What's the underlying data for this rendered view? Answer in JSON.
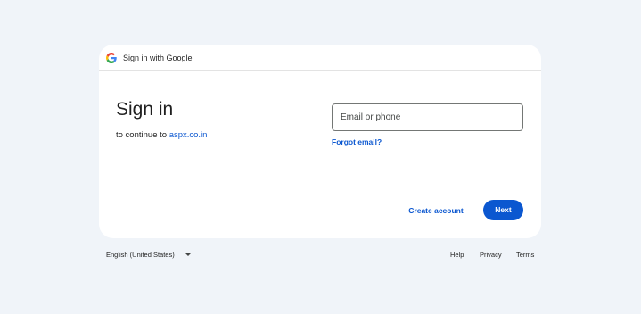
{
  "header": {
    "logo": "google-g-icon",
    "text": "Sign in with Google"
  },
  "main": {
    "title": "Sign in",
    "subtitle_prefix": "to continue to ",
    "subtitle_link": "aspx.co.in"
  },
  "form": {
    "email_placeholder": "Email or phone",
    "email_value": "",
    "forgot_email": "Forgot email?"
  },
  "actions": {
    "create_account": "Create account",
    "next": "Next"
  },
  "footer": {
    "language": "English (United States)",
    "help": "Help",
    "privacy": "Privacy",
    "terms": "Terms"
  },
  "colors": {
    "page_background": "#f0f4f9",
    "card_background": "#ffffff",
    "accent": "#0b57d0",
    "text": "#1f1f1f"
  }
}
